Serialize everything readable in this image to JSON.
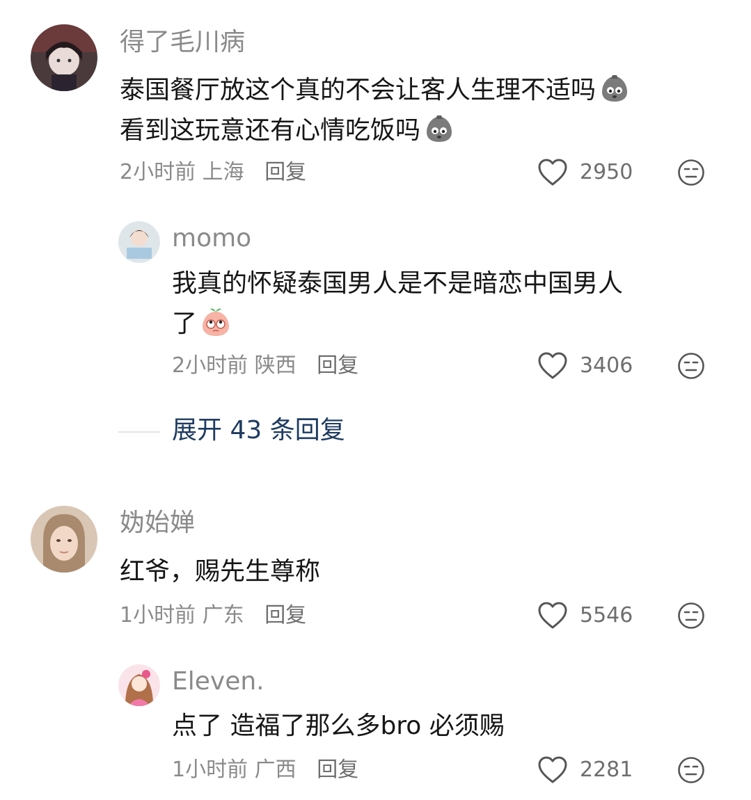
{
  "comments": [
    {
      "username": "得了毛川病",
      "lines": [
        "泰国餐厅放这个真的不会让客人生理不适吗",
        "看到这玩意还有心情吃饭吗"
      ],
      "emoji": "grey-sweat-emoji",
      "time": "2小时前",
      "location": "上海",
      "reply": "回复",
      "likes": "2950",
      "replies": [
        {
          "username": "momo",
          "lines": [
            "我真的怀疑泰国男人是不是暗恋中国男人",
            "了"
          ],
          "emoji": "peach-rolling-eyes-emoji",
          "time": "2小时前",
          "location": "陕西",
          "reply": "回复",
          "likes": "3406"
        }
      ],
      "expand": "展开 43 条回复"
    },
    {
      "username": "妫始婵",
      "lines": [
        "红爷，赐先生尊称"
      ],
      "time": "1小时前",
      "location": "广东",
      "reply": "回复",
      "likes": "5546",
      "replies": [
        {
          "username": "Eleven.",
          "lines": [
            "点了 造福了那么多bro 必须赐"
          ],
          "time": "1小时前",
          "location": "广西",
          "reply": "回复",
          "likes": "2281"
        }
      ]
    }
  ],
  "icons": {
    "like": "heart-outline-icon",
    "dislike": "unhappy-face-icon"
  },
  "colors": {
    "text": "#161616",
    "meta": "#8a8a8a",
    "expand": "#1f3b61",
    "divider": "#e4e4e4"
  }
}
